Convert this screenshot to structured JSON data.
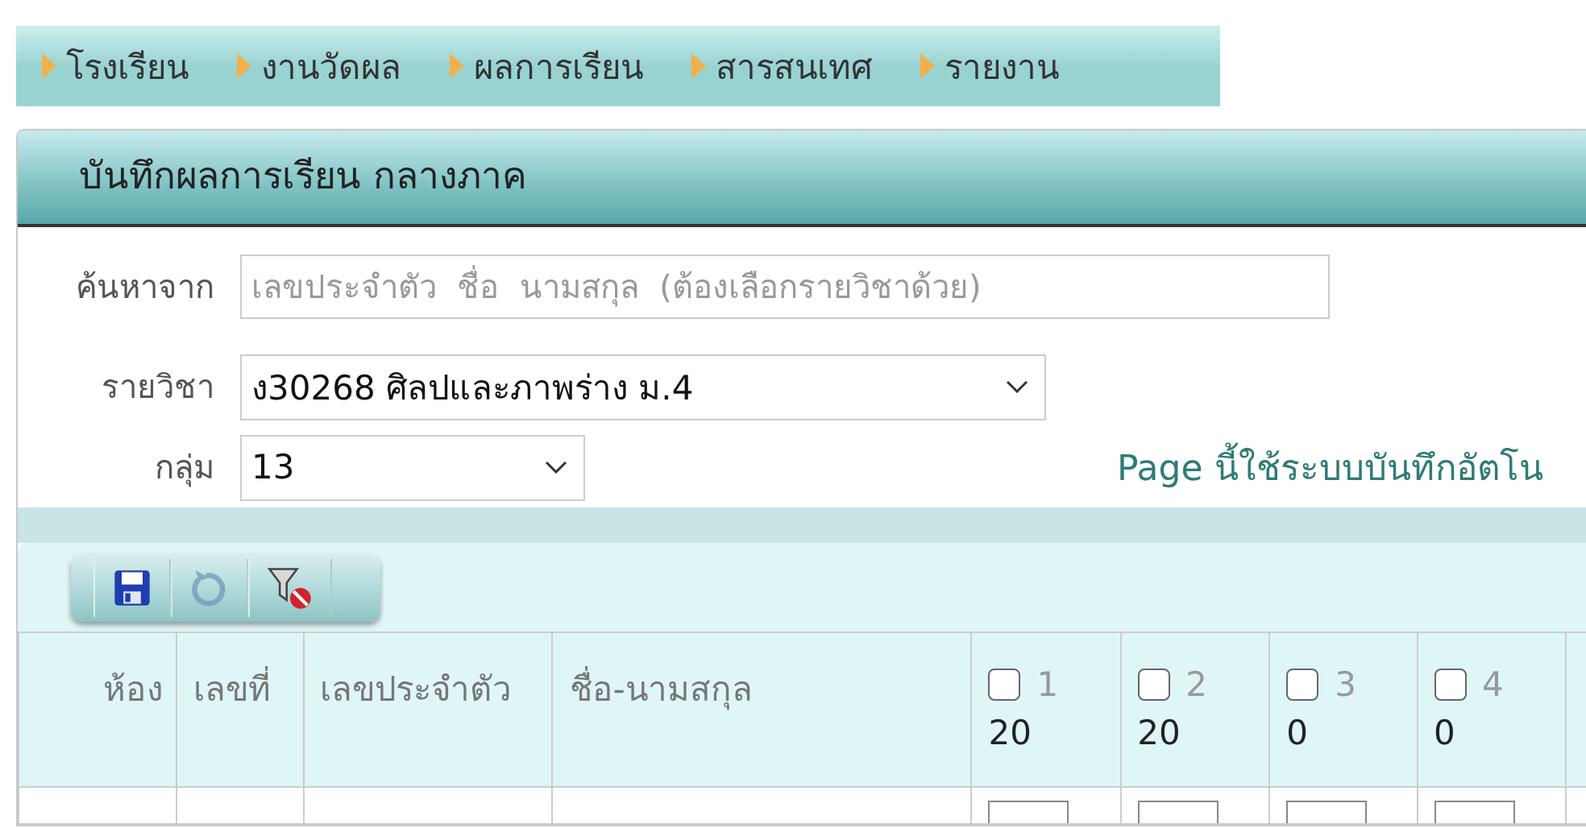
{
  "nav": [
    {
      "label": "โรงเรียน"
    },
    {
      "label": "งานวัดผล"
    },
    {
      "label": "ผลการเรียน"
    },
    {
      "label": "สารสนเทศ"
    },
    {
      "label": "รายงาน"
    }
  ],
  "panel_title": "บันทึกผลการเรียน  กลางภาค",
  "search": {
    "label": "ค้นหาจาก",
    "placeholder": "เลขประจำตัว  ชื่อ  นามสกุล  (ต้องเลือกรายวิชาด้วย)"
  },
  "subject": {
    "label": "รายวิชา",
    "value": "ง30268  ศิลปและภาพร่าง  ม.4"
  },
  "group": {
    "label": "กลุ่ม",
    "value": "13"
  },
  "note": "Page นี้ใช้ระบบบันทึกอัตโน",
  "toolbar": [
    {
      "kind": "save",
      "disabled": false
    },
    {
      "kind": "undo",
      "disabled": true
    },
    {
      "kind": "clear-filter",
      "disabled": false
    }
  ],
  "table": {
    "columns": [
      {
        "kind": "text",
        "label": "ห้อง"
      },
      {
        "kind": "text",
        "label": "เลขที่"
      },
      {
        "kind": "text",
        "label": "เลขประจำตัว"
      },
      {
        "kind": "text",
        "label": "ชื่อ-นามสกุล"
      },
      {
        "kind": "score",
        "label": "1",
        "checked": false,
        "max": "20"
      },
      {
        "kind": "score",
        "label": "2",
        "checked": false,
        "max": "20"
      },
      {
        "kind": "score",
        "label": "3",
        "checked": false,
        "max": "0"
      },
      {
        "kind": "score",
        "label": "4",
        "checked": false,
        "max": "0"
      }
    ]
  }
}
